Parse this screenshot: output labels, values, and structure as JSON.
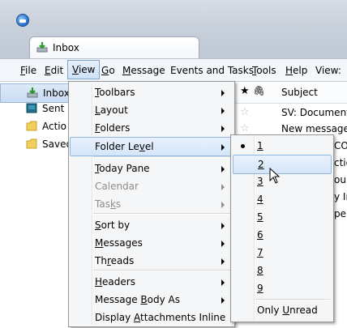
{
  "tab": {
    "label": "Inbox"
  },
  "menubar": {
    "items": [
      "File",
      "Edit",
      "View",
      "Go",
      "Message",
      "Events and Tasks",
      "Tools",
      "Help",
      "View:"
    ]
  },
  "folders": [
    {
      "label": "Inbox",
      "icon": "inbox-icon"
    },
    {
      "label": "Sent",
      "icon": "sent-icon"
    },
    {
      "label": "Actio",
      "icon": "folder-icon"
    },
    {
      "label": "Saved",
      "icon": "folder-icon"
    }
  ],
  "thread_pane": {
    "header_subject": "Subject",
    "rows": [
      "SV: Documents",
      "New message f",
      "CO",
      "ctio",
      "our",
      "y In",
      "pe"
    ]
  },
  "view_menu": {
    "items": [
      {
        "pre": "",
        "u": "T",
        "post": "oolbars",
        "submenu": true
      },
      {
        "pre": "",
        "u": "L",
        "post": "ayout",
        "submenu": true
      },
      {
        "pre": "",
        "u": "F",
        "post": "olders",
        "submenu": true
      },
      {
        "pre": "Folder Le",
        "u": "v",
        "post": "el",
        "submenu": true
      },
      {
        "pre": "",
        "u": "T",
        "post": "oday Pane",
        "submenu": true
      },
      {
        "pre": "Calendar",
        "u": "",
        "post": "",
        "submenu": true
      },
      {
        "pre": "Tas",
        "u": "k",
        "post": "s",
        "submenu": true
      },
      {
        "pre": "",
        "u": "S",
        "post": "ort by",
        "submenu": true
      },
      {
        "pre": "",
        "u": "M",
        "post": "essages",
        "submenu": true
      },
      {
        "pre": "Th",
        "u": "r",
        "post": "eads",
        "submenu": true
      },
      {
        "pre": "",
        "u": "H",
        "post": "eaders",
        "submenu": true
      },
      {
        "pre": "Message ",
        "u": "B",
        "post": "ody As",
        "submenu": true
      },
      {
        "pre": "Display ",
        "u": "A",
        "post": "ttachments Inline",
        "submenu": false
      }
    ]
  },
  "folder_level_menu": {
    "selected": "1",
    "hovered": "2",
    "levels": [
      "1",
      "2",
      "3",
      "4",
      "5",
      "6",
      "7",
      "8",
      "9"
    ],
    "only_unread": {
      "pre": "Only ",
      "u": "U",
      "post": "nread"
    }
  },
  "colors": {
    "highlight": "#d4e5f9",
    "highlight_border": "#93b7e3",
    "menu_bg": "#f5f6f7"
  }
}
